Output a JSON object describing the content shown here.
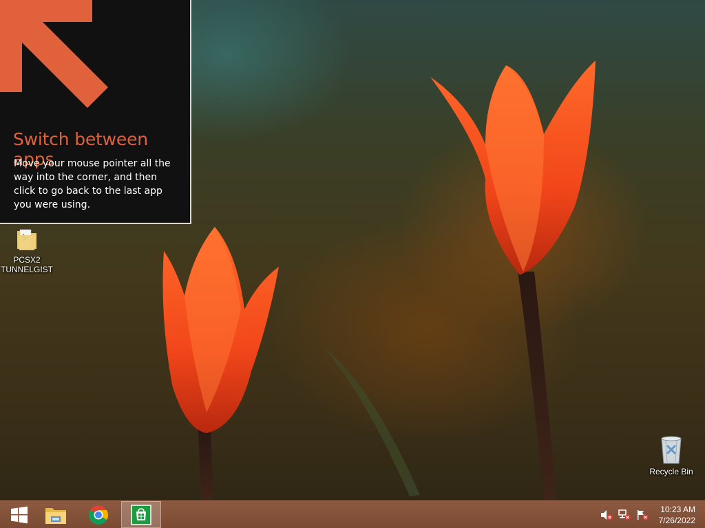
{
  "tip": {
    "title": "Switch between apps",
    "body": "Move your mouse pointer all the way into the corner, and then click to go back to the last app you were using.",
    "accent_color": "#e0613b"
  },
  "desktop": {
    "icons": [
      {
        "label": "PCSX2\nTUNNELGIST",
        "icon": "folder-icon"
      },
      {
        "label": "Recycle Bin",
        "icon": "recycle-bin-icon"
      }
    ]
  },
  "taskbar": {
    "buttons": [
      {
        "name": "start",
        "icon": "windows-logo-icon"
      },
      {
        "name": "file-explorer",
        "icon": "file-explorer-icon"
      },
      {
        "name": "chrome",
        "icon": "chrome-icon"
      },
      {
        "name": "store",
        "icon": "store-icon",
        "active": true
      }
    ],
    "tray_icons": [
      "volume-muted-icon",
      "network-icon",
      "action-center-flag-icon"
    ],
    "clock": {
      "time": "10:23 AM",
      "date": "7/26/2022"
    }
  }
}
